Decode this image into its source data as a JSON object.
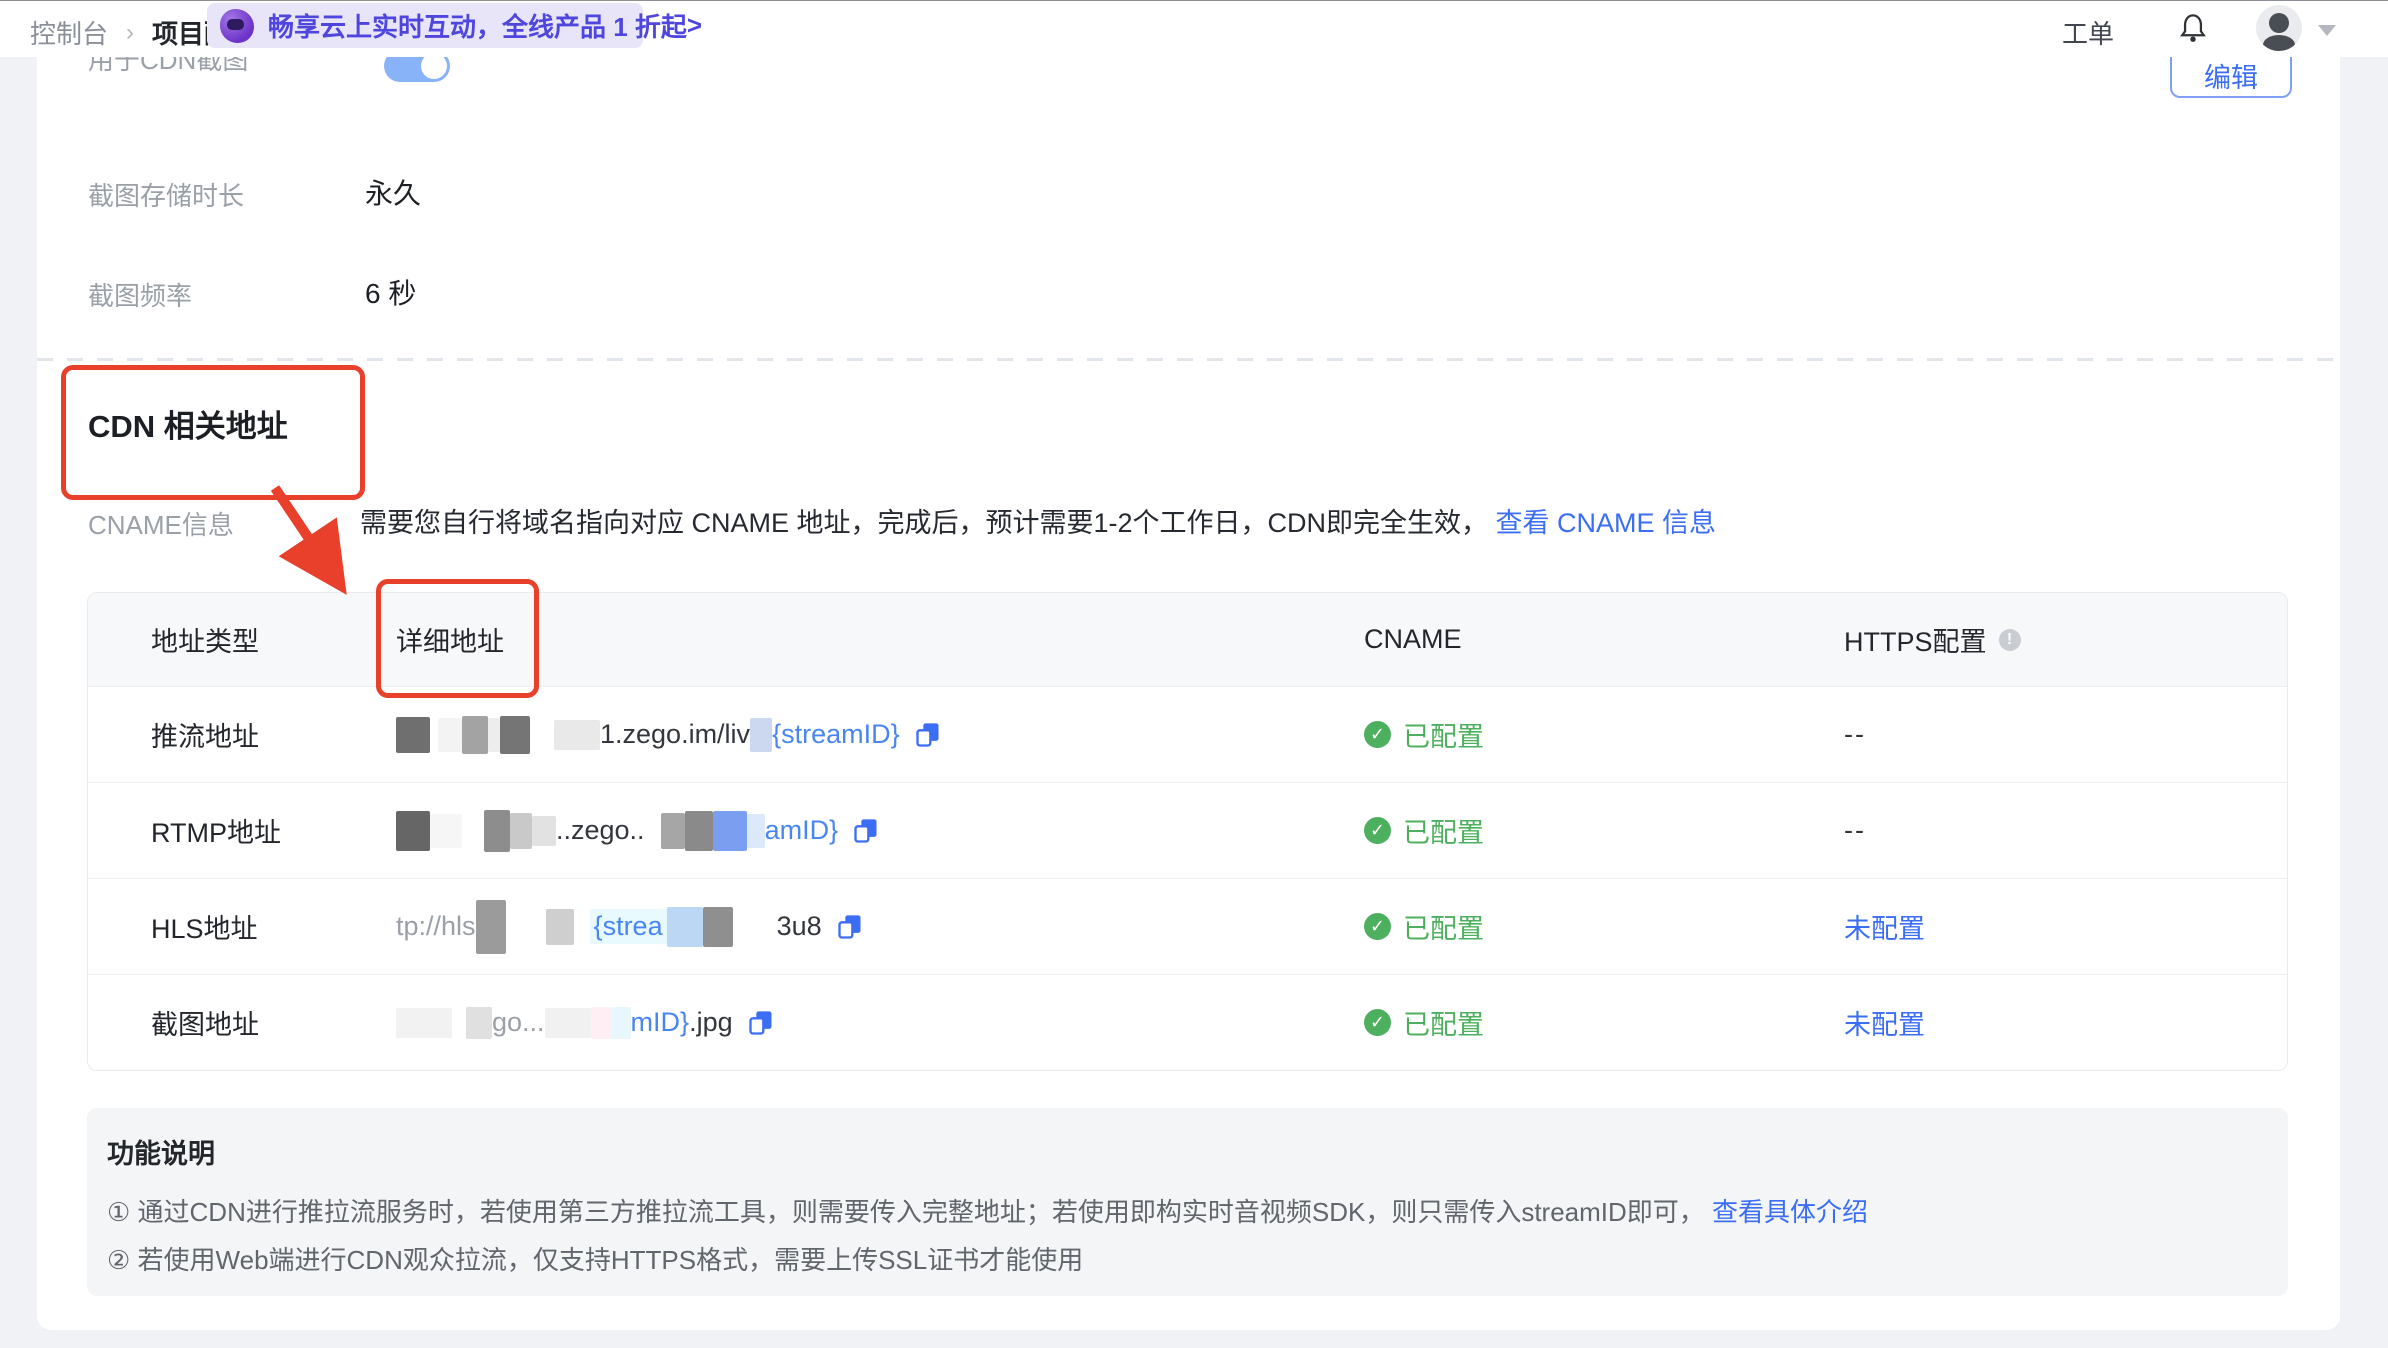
{
  "topbar": {
    "breadcrumb": [
      "控制台",
      "项目配置"
    ],
    "banner": {
      "text": "畅享云上实时互动，全线产品 1 折起",
      "arrow": ">"
    },
    "ticket_label": "工单"
  },
  "settings": {
    "edit_button": "编辑",
    "rows": [
      {
        "label": "用于CDN截图",
        "control": "toggle",
        "state": "on"
      },
      {
        "label": "截图存储时长",
        "value": "永久"
      },
      {
        "label": "截图频率",
        "value": "6 秒"
      }
    ]
  },
  "cdn_section": {
    "title": "CDN 相关地址",
    "cname_label": "CNAME信息",
    "cname_desc": "需要您自行将域名指向对应 CNAME 地址，完成后，预计需要1-2个工作日，CDN即完全生效，",
    "cname_link": "查看 CNAME 信息"
  },
  "table": {
    "headers": [
      "地址类型",
      "详细地址",
      "CNAME",
      "HTTPS配置"
    ],
    "rows": [
      {
        "type": "推流地址",
        "frag1": "1.zego.im/liv",
        "var": "{streamID}",
        "tail": "",
        "cname": "已配置",
        "https": "--"
      },
      {
        "type": "RTMP地址",
        "frag1": "..zego..",
        "var": "amID}",
        "tail": "",
        "cname": "已配置",
        "https": "--"
      },
      {
        "type": "HLS地址",
        "frag1": "tp://hls",
        "var": "{strea",
        "tail": "3u8",
        "cname": "已配置",
        "https": "未配置"
      },
      {
        "type": "截图地址",
        "frag1": "go...",
        "var": "mID}",
        "tail": ".jpg",
        "cname": "已配置",
        "https": "未配置"
      }
    ]
  },
  "notes": {
    "title": "功能说明",
    "line1": "① 通过CDN进行推拉流服务时，若使用第三方推拉流工具，则需要传入完整地址；若使用即构实时音视频SDK，则只需传入streamID即可，",
    "line1_link": "查看具体介绍",
    "line2": "② 若使用Web端进行CDN观众拉流，仅支持HTTPS格式，需要上传SSL证书才能使用"
  },
  "icons": {
    "copy": "copy-icon",
    "bell": "notification-bell-icon",
    "info": "info-exclamation-icon",
    "check": "green-check-icon"
  },
  "accent_colors": {
    "link_blue": "#3b6ef5",
    "success_green": "#4cb05e",
    "annotation_red": "#e8402a",
    "banner_purple": "#4f46dd",
    "toggle_blue": "#89b3f8"
  }
}
